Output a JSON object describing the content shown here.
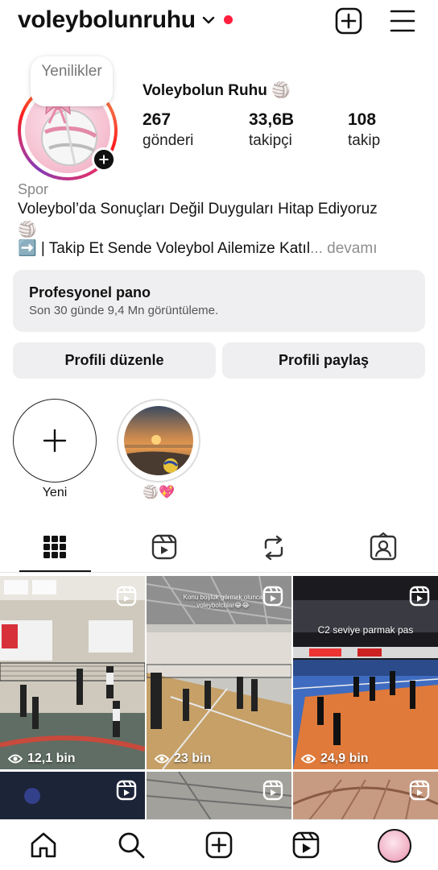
{
  "header": {
    "username": "voleybolunruhu",
    "icons": [
      "chevron-down-icon",
      "notification-dot",
      "create-plus-icon",
      "menu-icon"
    ],
    "accent_dot_color": "#ff1e3c"
  },
  "profile": {
    "note_text": "Yenilikler",
    "display_name": "Voleybolun Ruhu 🏐",
    "stats": [
      {
        "value": "267",
        "label": "gönderi"
      },
      {
        "value": "33,6B",
        "label": "takipçi"
      },
      {
        "value": "108",
        "label": "takip"
      }
    ],
    "category": "Spor",
    "bio_line1": "Voleybol’da Sonuçları Değil Duyguları Hitap Ediyoruz",
    "bio_line2_icon": "🏐",
    "bio_line3": "➡️ | Takip Et Sende Voleybol Ailemize Katıl",
    "bio_more": "... devamı"
  },
  "dashboard": {
    "title": "Profesyonel pano",
    "subtitle": "Son 30 günde 9,4 Mn görüntüleme."
  },
  "buttons": {
    "edit_profile": "Profili düzenle",
    "share_profile": "Profili paylaş"
  },
  "highlights": [
    {
      "label": "Yeni"
    },
    {
      "label": "🏐💖"
    }
  ],
  "tabs": [
    "grid-icon",
    "reels-icon",
    "reposts-icon",
    "tagged-icon"
  ],
  "grid": {
    "posts": [
      {
        "views": "12,1 bin",
        "caption": ""
      },
      {
        "views": "23 bin",
        "caption": "Konu boşluk görmek olunca voleybolcular😂😂"
      },
      {
        "views": "24,9 bin",
        "caption": "C2 seviye parmak pas"
      },
      {
        "views": "",
        "caption": ""
      },
      {
        "views": "",
        "caption": ""
      },
      {
        "views": "",
        "caption": ""
      }
    ]
  },
  "bottom_nav": [
    "home-icon",
    "search-icon",
    "create-icon",
    "reels-nav-icon",
    "profile-avatar"
  ]
}
